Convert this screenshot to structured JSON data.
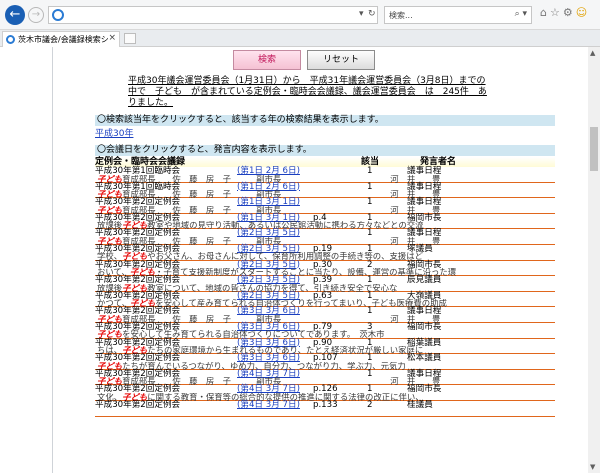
{
  "browser": {
    "address_placeholder": "",
    "search_placeholder": "検索...",
    "tab_title": "茨木市議会/会議録検索シス...",
    "tab_close": "×"
  },
  "buttons": {
    "search_label": "検索",
    "reset_label": "リセット"
  },
  "summary": "平成30年議会運営委員会（1月31日）から　平成31年議会運営委員会（3月8日）までの中で　子ども　が含まれている定例会・臨時会会議録、議会運営委員会　は　245件　ありました。",
  "year_panel": {
    "heading": "〇検索該当年をクリックすると、該当する年の検索結果を表示します。",
    "year_link": "平成30年"
  },
  "meeting_panel": {
    "heading": "〇会議日をクリックすると、発言内容を表示します。"
  },
  "table": {
    "headers": {
      "meeting": "定例会・臨時会会議録",
      "count": "該当",
      "speaker": "発言者名"
    },
    "rows": [
      {
        "meeting": "平成30年第1回臨時会",
        "date": "(第1日 2月 6日)",
        "page": "",
        "count": "1",
        "speaker": "議事日程",
        "pre": "",
        "kw": "子ども",
        "post": "育成部長　　佐　藤　房　子　　　副市長　　　　　　　　　　　　　河　井　　豊"
      },
      {
        "meeting": "平成30年第1回臨時会",
        "date": "(第1日 2月 6日)",
        "page": "",
        "count": "1",
        "speaker": "議事日程",
        "pre": "",
        "kw": "子ども",
        "post": "育成部長　　佐　藤　房　子　　　副市長　　　　　　　　　　　　　河　井　　豊"
      },
      {
        "meeting": "平成30年第2回定例会",
        "date": "(第1日 3月 1日)",
        "page": "",
        "count": "1",
        "speaker": "議事日程",
        "pre": "",
        "kw": "子ども",
        "post": "育成部長　　佐　藤　房　子　　　副市長　　　　　　　　　　　　　河　井　　豊"
      },
      {
        "meeting": "平成30年第2回定例会",
        "date": "(第1日 3月 1日)",
        "page": "p.4",
        "count": "1",
        "speaker": "福岡市長",
        "pre": "放課後",
        "kw": "子ども",
        "post": "教室や地域の見守り活動、あるいは公民館活動に携わる方々などとの交流"
      },
      {
        "meeting": "平成30年第2回定例会",
        "date": "(第2日 3月 5日)",
        "page": "",
        "count": "1",
        "speaker": "議事日程",
        "pre": "",
        "kw": "子ども",
        "post": "育成部長　　佐　藤　房　子　　　副市長　　　　　　　　　　　　　河　井　　豊"
      },
      {
        "meeting": "平成30年第2回定例会",
        "date": "(第2日 3月 5日)",
        "page": "p.19",
        "count": "1",
        "speaker": "塚議員",
        "pre": "学校、",
        "kw": "子ども",
        "post": "やお父さん、お母さんに対して、保育所利用調整の手続き等の、支援はど"
      },
      {
        "meeting": "平成30年第2回定例会",
        "date": "(第2日 3月 5日)",
        "page": "p.30",
        "count": "2",
        "speaker": "福岡市長",
        "pre": "おいて、",
        "kw": "子ども",
        "post": "・子育て支援新制度がスタートすることに当たり、設備、運営の基準に沿った環"
      },
      {
        "meeting": "平成30年第2回定例会",
        "date": "(第2日 3月 5日)",
        "page": "p.39",
        "count": "1",
        "speaker": "辰見議員",
        "pre": "放課後",
        "kw": "子ども",
        "post": "教室について、地域の皆さんの協力を得て、引き続き安全で安心な"
      },
      {
        "meeting": "平成30年第2回定例会",
        "date": "(第2日 3月 5日)",
        "page": "p.63",
        "count": "1",
        "speaker": "大嶺議員",
        "pre": "かつて、",
        "kw": "子ども",
        "post": "を安心して産み育てられる自治体づくりを行ってまいり、子ども医療費の助成"
      },
      {
        "meeting": "平成30年第2回定例会",
        "date": "(第3日 3月 6日)",
        "page": "",
        "count": "1",
        "speaker": "議事日程",
        "pre": "",
        "kw": "子ども",
        "post": "育成部長　　佐　藤　房　子　　　副市長　　　　　　　　　　　　　河　井　　豊"
      },
      {
        "meeting": "平成30年第2回定例会",
        "date": "(第3日 3月 6日)",
        "page": "p.79",
        "count": "3",
        "speaker": "福岡市長",
        "pre": "",
        "kw": "子ども",
        "post": "を安心して生み育てられる自治体づくりについてであります。　茨木市"
      },
      {
        "meeting": "平成30年第2回定例会",
        "date": "(第3日 3月 6日)",
        "page": "p.90",
        "count": "1",
        "speaker": "稲葉議員",
        "pre": "ちは、",
        "kw": "子ども",
        "post": "たちの家庭環境から生まれるものであり、たとえ経済状況が厳しい家庭に"
      },
      {
        "meeting": "平成30年第2回定例会",
        "date": "(第3日 3月 6日)",
        "page": "p.107",
        "count": "1",
        "speaker": "松本議員",
        "pre": "",
        "kw": "子ども",
        "post": "たちが育んでいるつながり、ゆめ力、自分力、つながり力、学ぶ力、元気力"
      },
      {
        "meeting": "平成30年第2回定例会",
        "date": "(第4日 3月 7日)",
        "page": "",
        "count": "1",
        "speaker": "議事日程",
        "pre": "",
        "kw": "子ども",
        "post": "育成部長　　佐　藤　房　子　　　副市長　　　　　　　　　　　　　河　井　　豊"
      },
      {
        "meeting": "平成30年第2回定例会",
        "date": "(第4日 3月 7日)",
        "page": "p.126",
        "count": "1",
        "speaker": "福岡市長",
        "pre": "文化、",
        "kw": "子ども",
        "post": "に関する教育・保育等の総合的な提供の推進に関する法律の改正に伴い、"
      },
      {
        "meeting": "平成30年第2回定例会",
        "date": "(第4日 3月 7日)",
        "page": "p.133",
        "count": "2",
        "speaker": "桂議員",
        "pre": "",
        "kw": "",
        "post": ""
      }
    ]
  }
}
